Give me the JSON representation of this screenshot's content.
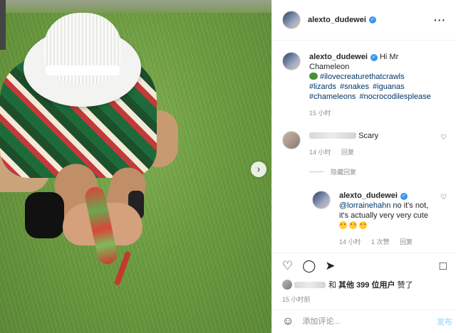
{
  "post": {
    "username": "alexto_dudewei",
    "caption_greeting": "Hi Mr Chameleon",
    "hashtags": [
      "#ilovecreaturethatcrawls",
      "#lizards",
      "#snakes",
      "#iguanas",
      "#chameleons",
      "#nocrocodilesplease"
    ],
    "time": "15 小时"
  },
  "comments": [
    {
      "text": "Scary",
      "time": "14 小时",
      "reply_label": "回复",
      "hide_replies": "隐藏回复",
      "replies": [
        {
          "username": "alexto_dudewei",
          "mention": "@lorrainehahn",
          "text": "no it's not, it's actually very very cute",
          "time": "14 小时",
          "likes": "1 次赞",
          "reply_label": "回复"
        }
      ]
    }
  ],
  "likes": {
    "prefix": "和",
    "others": "其他 399 位用户",
    "suffix": "赞了"
  },
  "post_time": "15 小时前",
  "comment_box": {
    "placeholder": "添加评论...",
    "post_label": "发布"
  },
  "icons": {
    "more": "more-icon",
    "like": "heart-icon",
    "comment": "comment-icon",
    "share": "share-icon",
    "save": "bookmark-icon",
    "emoji": "smile-icon",
    "next": "chevron-right-icon"
  },
  "colors": {
    "verified": "#3897f0",
    "hashtag": "#00376b",
    "meta": "#8e8e8e",
    "post_button_disabled": "#b2dffc"
  }
}
